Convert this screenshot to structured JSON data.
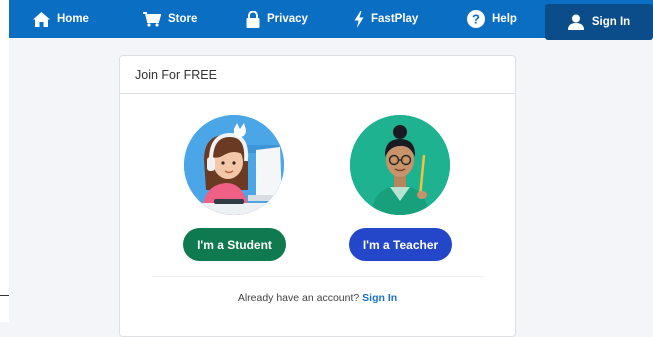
{
  "nav": {
    "home": "Home",
    "store": "Store",
    "privacy": "Privacy",
    "fastplay": "FastPlay",
    "help": "Help",
    "signin": "Sign In"
  },
  "icons": {
    "home": "home-icon",
    "store": "cart-icon",
    "privacy": "lock-icon",
    "fastplay": "lightning-icon",
    "help": "question-icon",
    "signin": "user-icon"
  },
  "card": {
    "title": "Join For FREE",
    "student_button": "I'm a Student",
    "teacher_button": "I'm a Teacher",
    "account_prompt": "Already have an account?",
    "signin_link": "Sign In"
  },
  "colors": {
    "nav_bg": "#0a6ec2",
    "signin_bg": "#0b4d8a",
    "student_btn": "#0f7a4f",
    "teacher_btn": "#2347c8",
    "link": "#1a73c7"
  }
}
